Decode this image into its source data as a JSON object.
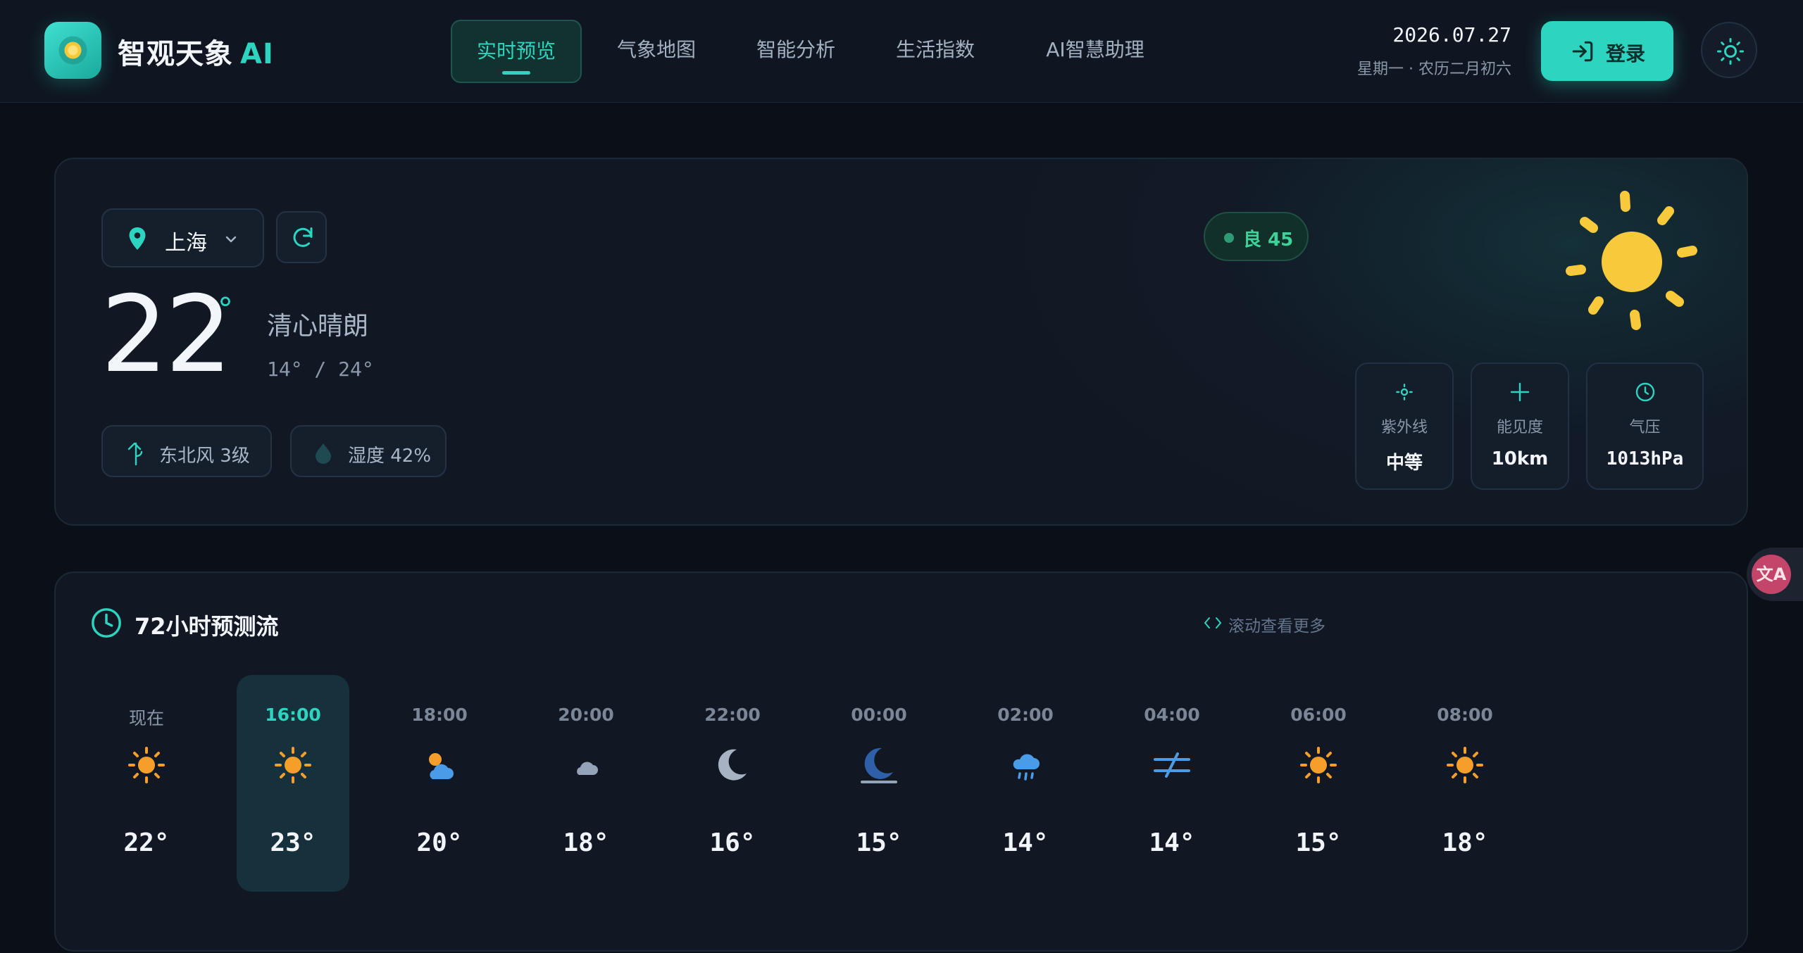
{
  "header": {
    "brand": "智观天象",
    "brand_ai": "AI",
    "nav": [
      {
        "label": "实时预览",
        "active": true
      },
      {
        "label": "气象地图",
        "active": false
      },
      {
        "label": "智能分析",
        "active": false
      },
      {
        "label": "生活指数",
        "active": false
      },
      {
        "label": "AI智慧助理",
        "active": false
      }
    ],
    "date": "2026.07.27",
    "lunar": "星期一 · 农历二月初六",
    "login_label": "登录"
  },
  "current": {
    "city": "上海",
    "temperature": "22",
    "degree_symbol": "°",
    "condition": "清心晴朗",
    "range": "14° / 24°",
    "wind": "东北风  3级",
    "humidity": "湿度  42%",
    "aqi": "良 45",
    "stats": [
      {
        "icon": "sun-small-icon",
        "label": "紫外线",
        "value": "中等"
      },
      {
        "icon": "plus-icon",
        "label": "能见度",
        "value": "10km"
      },
      {
        "icon": "gauge-icon",
        "label": "气压",
        "value": "1013hPa"
      }
    ]
  },
  "forecast": {
    "title": "72小时预测流",
    "hint": "滚动查看更多",
    "hours": [
      {
        "time": "现在",
        "icon": "sunny-icon",
        "temp": "22°"
      },
      {
        "time": "16:00",
        "icon": "sunny-icon",
        "temp": "23°",
        "active": true
      },
      {
        "time": "18:00",
        "icon": "partly-cloudy-icon",
        "temp": "20°"
      },
      {
        "time": "20:00",
        "icon": "cloud-icon",
        "temp": "18°"
      },
      {
        "time": "22:00",
        "icon": "moon-icon",
        "temp": "16°"
      },
      {
        "time": "00:00",
        "icon": "moon-horizon-icon",
        "temp": "15°"
      },
      {
        "time": "02:00",
        "icon": "rain-icon",
        "temp": "14°"
      },
      {
        "time": "04:00",
        "icon": "wind-icon",
        "temp": "14°"
      },
      {
        "time": "06:00",
        "icon": "sunny-icon",
        "temp": "15°"
      },
      {
        "time": "08:00",
        "icon": "sunny-icon",
        "temp": "18°"
      }
    ]
  },
  "colors": {
    "accent": "#2dd4bf",
    "background": "#0b1018",
    "card": "#111824",
    "sun": "#f8c93a",
    "aqi_good": "#3ed29a"
  }
}
